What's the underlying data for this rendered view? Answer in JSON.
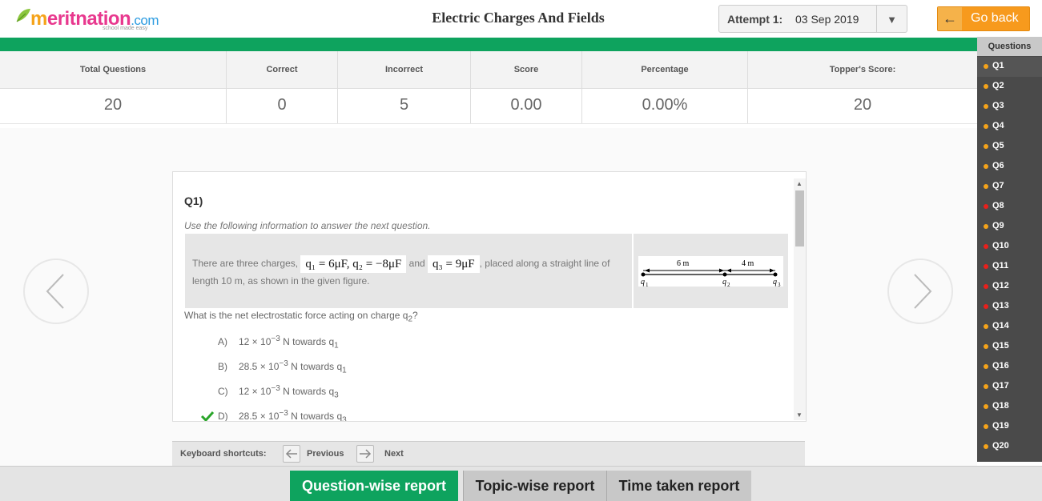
{
  "header": {
    "logo_m": "m",
    "logo_rest": "eritnation",
    "logo_com": ".com",
    "logo_tagline": "school made easy",
    "title": "Electric Charges And Fields",
    "attempt_label": "Attempt 1:",
    "attempt_date": "03 Sep 2019",
    "dropdown_icon": "▼",
    "goback_label": "Go back",
    "goback_icon": "←"
  },
  "stats": {
    "headers": [
      "Total Questions",
      "Correct",
      "Incorrect",
      "Score",
      "Percentage",
      "Topper's Score:"
    ],
    "values": [
      "20",
      "0",
      "5",
      "0.00",
      "0.00%",
      "20"
    ]
  },
  "question": {
    "number": "Q1)",
    "instruction": "Use the following information to answer the next question.",
    "text_a": "There are three charges,",
    "math_1": "q₁ = 6μF,  q₂ = −8μF",
    "text_b": "and",
    "math_2": "q₃ = 9μF",
    "text_c": ", placed along a straight line of length 10 m, as shown in the given figure.",
    "figure": {
      "dist1": "6 m",
      "dist2": "4 m",
      "q1": "q",
      "q1_sub": "1",
      "q2": "q",
      "q2_sub": "2",
      "q3": "q",
      "q3_sub": "3"
    },
    "ask": "What is the net electrostatic force acting on charge q",
    "ask_sub": "2",
    "ask_end": "?",
    "options": [
      {
        "letter": "A)",
        "text": "12 × 10",
        "exp": "−3",
        "unit": " N towards q",
        "sub": "1"
      },
      {
        "letter": "B)",
        "text": "28.5 × 10",
        "exp": "−3",
        "unit": " N towards q",
        "sub": "1"
      },
      {
        "letter": "C)",
        "text": "12 × 10",
        "exp": "−3",
        "unit": " N towards q",
        "sub": "3"
      },
      {
        "letter": "D)",
        "text": "28.5 × 10",
        "exp": "−3",
        "unit": " N towards q",
        "sub": "3"
      }
    ],
    "correct_option": "D"
  },
  "keyboard": {
    "label": "Keyboard shortcuts:",
    "prev": "Previous",
    "next": "Next"
  },
  "tabs": [
    "Question-wise report",
    "Topic-wise report",
    "Time taken report"
  ],
  "sidebar": {
    "title": "Questions",
    "items": [
      {
        "label": "Q1",
        "status": "orange"
      },
      {
        "label": "Q2",
        "status": "orange"
      },
      {
        "label": "Q3",
        "status": "orange"
      },
      {
        "label": "Q4",
        "status": "orange"
      },
      {
        "label": "Q5",
        "status": "orange"
      },
      {
        "label": "Q6",
        "status": "orange"
      },
      {
        "label": "Q7",
        "status": "orange"
      },
      {
        "label": "Q8",
        "status": "red"
      },
      {
        "label": "Q9",
        "status": "orange"
      },
      {
        "label": "Q10",
        "status": "red"
      },
      {
        "label": "Q11",
        "status": "red"
      },
      {
        "label": "Q12",
        "status": "red"
      },
      {
        "label": "Q13",
        "status": "red"
      },
      {
        "label": "Q14",
        "status": "orange"
      },
      {
        "label": "Q15",
        "status": "orange"
      },
      {
        "label": "Q16",
        "status": "orange"
      },
      {
        "label": "Q17",
        "status": "orange"
      },
      {
        "label": "Q18",
        "status": "orange"
      },
      {
        "label": "Q19",
        "status": "orange"
      },
      {
        "label": "Q20",
        "status": "orange"
      }
    ]
  },
  "colors": {
    "brand_green": "#0ea35e",
    "orange": "#f5a31a",
    "red": "#e8201c",
    "check": "#2aa52a"
  }
}
